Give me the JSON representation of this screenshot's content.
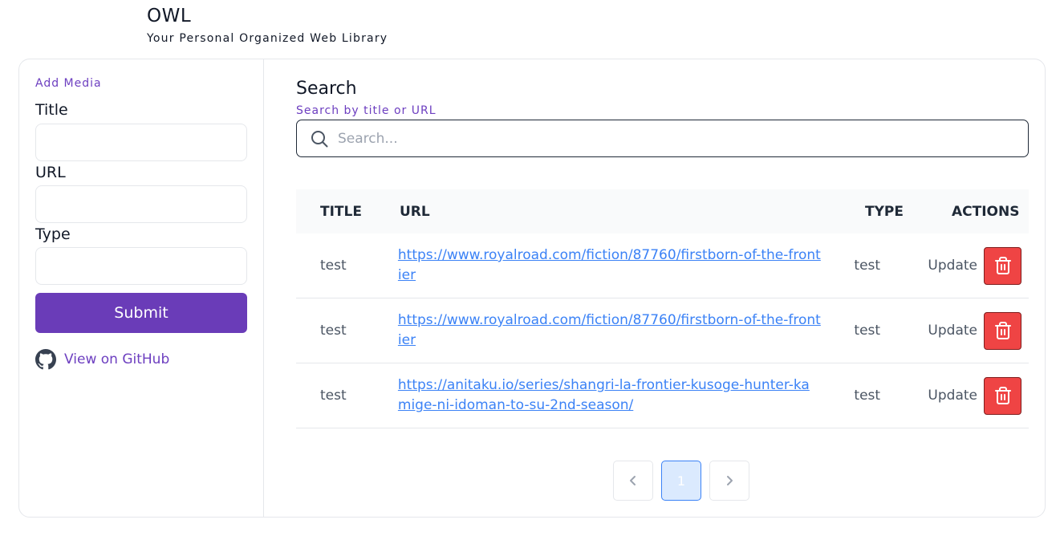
{
  "header": {
    "title": "OWL",
    "subtitle": "Your Personal Organized Web Library"
  },
  "sidebar": {
    "heading": "Add Media",
    "fields": [
      {
        "label": "Title",
        "value": "",
        "placeholder": ""
      },
      {
        "label": "URL",
        "value": "",
        "placeholder": ""
      },
      {
        "label": "Type",
        "value": "",
        "placeholder": ""
      }
    ],
    "submit_label": "Submit",
    "github_label": "View on GitHub"
  },
  "search": {
    "title": "Search",
    "subtitle": "Search by title or URL",
    "placeholder": "Search...",
    "value": ""
  },
  "table": {
    "columns": [
      "TITLE",
      "URL",
      "TYPE",
      "ACTIONS"
    ],
    "rows": [
      {
        "title": "test",
        "url": "https://www.royalroad.com/fiction/87760/firstborn-of-the-frontier",
        "type": "test",
        "update_label": "Update"
      },
      {
        "title": "test",
        "url": "https://www.royalroad.com/fiction/87760/firstborn-of-the-frontier",
        "type": "test",
        "update_label": "Update"
      },
      {
        "title": "test",
        "url": "https://anitaku.io/series/shangri-la-frontier-kusoge-hunter-kamige-ni-idoman-to-su-2nd-season/",
        "type": "test",
        "update_label": "Update"
      }
    ]
  },
  "pagination": {
    "current_page": "1"
  },
  "colors": {
    "accent": "#6a3cb8",
    "link": "#3b82f6",
    "danger": "#ef4444"
  },
  "icons": {
    "search": "search-icon",
    "github": "github-icon",
    "delete": "trash-icon",
    "prev": "chevron-left-icon",
    "next": "chevron-right-icon"
  }
}
